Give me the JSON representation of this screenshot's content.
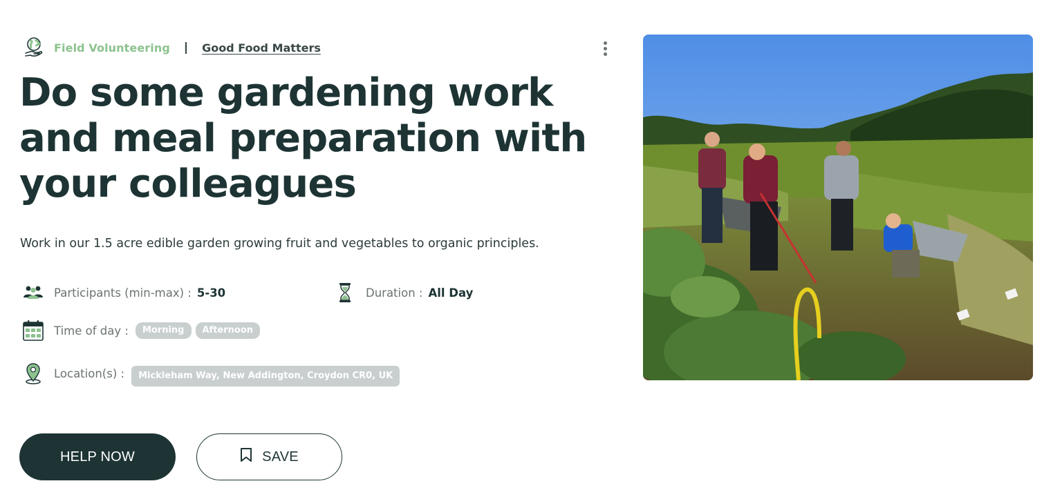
{
  "header": {
    "category": "Field Volunteering",
    "separator": "|",
    "organization": "Good Food Matters",
    "category_color": "#8cc28e"
  },
  "icons": {
    "category": "globe-hand-icon",
    "menu": "more-vertical-icon",
    "participants": "people-group-icon",
    "duration": "hourglass-icon",
    "time_of_day": "calendar-icon",
    "location": "map-pin-icon",
    "save": "bookmark-icon"
  },
  "title": "Do some gardening work and meal preparation with your colleagues",
  "description": "Work in our 1.5 acre edible garden growing fruit and vegetables to organic principles.",
  "details": {
    "participants": {
      "label": "Participants (min-max) :",
      "value": "5-30"
    },
    "duration": {
      "label": "Duration :",
      "value": "All Day"
    },
    "time_of_day": {
      "label": "Time of day :",
      "chips": [
        "Morning",
        "Afternoon"
      ]
    },
    "locations": {
      "label": "Location(s) :",
      "chips": [
        "Mickleham Way, New Addington, Croydon CR0, UK"
      ]
    }
  },
  "actions": {
    "help": "HELP NOW",
    "save": "SAVE"
  },
  "colors": {
    "primary": "#1e3434",
    "accent_green": "#8cc28e",
    "chip_bg": "#c9cfcf"
  }
}
